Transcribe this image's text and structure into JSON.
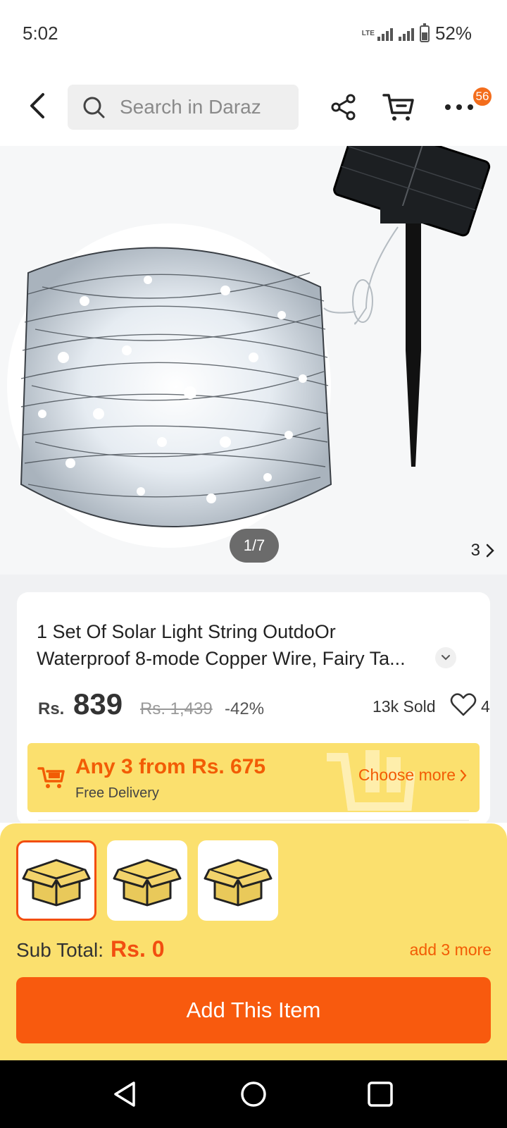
{
  "status_bar": {
    "time": "5:02",
    "network": "LTE",
    "battery": "52%"
  },
  "header": {
    "search_placeholder": "Search in Daraz",
    "cart_badge": "56"
  },
  "gallery": {
    "counter": "1/7",
    "next_label": "3"
  },
  "product": {
    "title_line1": "1 Set Of Solar Light String OutdoOr",
    "title_line2": "Waterproof 8-mode Copper Wire, Fairy Ta...",
    "currency": "Rs.",
    "price": "839",
    "old_price": "Rs. 1,439",
    "discount": "-42%",
    "sold": "13k Sold",
    "favorites": "4"
  },
  "promo": {
    "title": "Any 3 from Rs. 675",
    "subtitle": "Free Delivery",
    "choose_more": "Choose more"
  },
  "bundle": {
    "subtotal_label": "Sub Total:",
    "subtotal_value": "Rs. 0",
    "add_more": "add 3 more",
    "add_button": "Add This Item"
  },
  "colors": {
    "accent": "#f85a0e",
    "promo_bg": "#fbe06e",
    "promo_text": "#f25c05"
  }
}
